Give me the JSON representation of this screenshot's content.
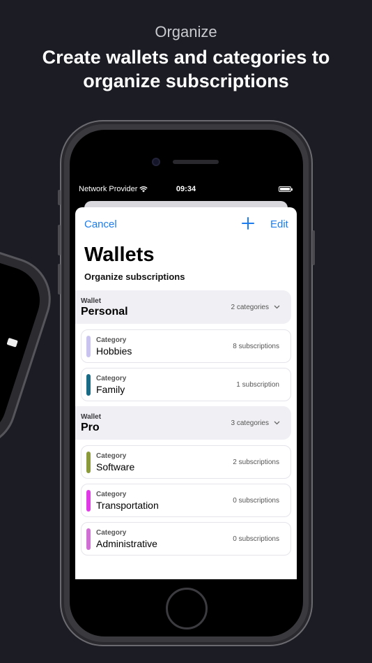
{
  "promo": {
    "kicker": "Organize",
    "headline": "Create wallets and categories to organize subscriptions"
  },
  "status_bar": {
    "carrier": "Network Provider",
    "time": "09:34",
    "icons": [
      "wifi-icon",
      "battery-icon"
    ]
  },
  "nav": {
    "cancel_label": "Cancel",
    "add_icon": "plus-icon",
    "edit_label": "Edit"
  },
  "page": {
    "title": "Wallets",
    "subtitle": "Organize subscriptions"
  },
  "wallets": [
    {
      "label": "Wallet",
      "name": "Personal",
      "count": "2 categories",
      "categories": [
        {
          "label": "Category",
          "name": "Hobbies",
          "count": "8 subscriptions",
          "color": "#c8c4ef"
        },
        {
          "label": "Category",
          "name": "Family",
          "count": "1 subscription",
          "color": "#1a6b86"
        }
      ]
    },
    {
      "label": "Wallet",
      "name": "Pro",
      "count": "3 categories",
      "categories": [
        {
          "label": "Category",
          "name": "Software",
          "count": "2 subscriptions",
          "color": "#8b9a3a"
        },
        {
          "label": "Category",
          "name": "Transportation",
          "count": "0 subscriptions",
          "color": "#e03ae6"
        },
        {
          "label": "Category",
          "name": "Administrative",
          "count": "0 subscriptions",
          "color": "#d070d4"
        }
      ]
    }
  ],
  "colors": {
    "background": "#1c1c24",
    "accent": "#1a7cf0",
    "wallet_bg": "#f0f0f4"
  }
}
